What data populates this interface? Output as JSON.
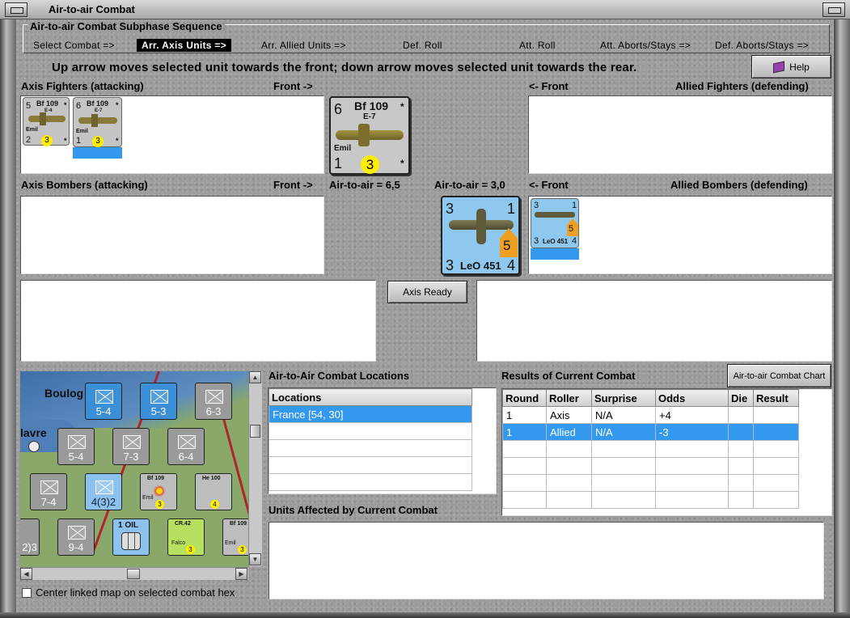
{
  "window": {
    "title": "Air-to-air Combat"
  },
  "sequence": {
    "title": "Air-to-air Combat Subphase Sequence",
    "steps": [
      {
        "label": "Select Combat =>"
      },
      {
        "label": "Arr. Axis Units =>"
      },
      {
        "label": "Arr. Allied Units =>"
      },
      {
        "label": "Def. Roll"
      },
      {
        "label": "Att. Roll"
      },
      {
        "label": "Att. Aborts/Stays =>"
      },
      {
        "label": "Def. Aborts/Stays =>"
      }
    ]
  },
  "instruction": "Up arrow moves selected unit towards the front; down arrow moves selected unit towards the rear.",
  "help_label": "Help",
  "axis_fighters": {
    "label": "Axis Fighters (attacking)",
    "front": "Front ->",
    "counters": [
      {
        "air": "5",
        "name": "Bf 109",
        "variant": "E-4",
        "pilot": "Emil",
        "range": "2",
        "defense": "3",
        "star": "*"
      },
      {
        "air": "6",
        "name": "Bf 109",
        "variant": "E-7",
        "pilot": "Emil",
        "range": "1",
        "defense": "3",
        "star": "*"
      }
    ]
  },
  "selected_axis": {
    "air": "6",
    "name": "Bf 109",
    "variant": "E-7",
    "pilot": "Emil",
    "range": "1",
    "defense": "3",
    "star": "*"
  },
  "allied_fighters": {
    "label": "Allied Fighters (defending)",
    "front": "<- Front"
  },
  "axis_bombers": {
    "label": "Axis Bombers (attacking)",
    "front": "Front ->",
    "air_to_air": "Air-to-air = 6,5"
  },
  "allied_bombers": {
    "label": "Allied Bombers (defending)",
    "front": "<- Front",
    "air_to_air": "Air-to-air = 3,0",
    "counters": [
      {
        "air": "3",
        "air2": "1",
        "name": "LeO 451",
        "bomb": "5",
        "range": "3",
        "move": "4"
      }
    ]
  },
  "selected_allied": {
    "air": "3",
    "air2": "1",
    "name": "LeO 451",
    "bomb": "5",
    "range": "3",
    "move": "4"
  },
  "axis_ready_label": "Axis Ready",
  "locations": {
    "title": "Air-to-Air Combat Locations",
    "header": "Locations",
    "rows": [
      "France [54, 30]"
    ]
  },
  "results": {
    "title": "Results of Current Combat",
    "chart_button": "Air-to-air Combat Chart",
    "columns": [
      "Round",
      "Roller",
      "Surprise",
      "Odds",
      "Die",
      "Result"
    ],
    "rows": [
      [
        "1",
        "Axis",
        "N/A",
        "+4",
        "",
        ""
      ],
      [
        "1",
        "Allied",
        "N/A",
        "-3",
        "",
        ""
      ]
    ]
  },
  "units_affected": {
    "title": "Units Affected by Current Combat"
  },
  "center_map_label": "Center linked map on selected combat hex",
  "map": {
    "labels": [
      "Boulog",
      "lavre"
    ],
    "units": [
      {
        "str": "5-4",
        "type": "xxx",
        "color": "#3a8fd6"
      },
      {
        "str": "5-3",
        "type": "xxx",
        "color": "#3a8fd6"
      },
      {
        "str": "6-3",
        "type": "xxxx",
        "color": "#9a9a9a"
      },
      {
        "str": "5-4",
        "type": "xxx",
        "color": "#9a9a9a"
      },
      {
        "str": "7-3",
        "type": "xxx",
        "color": "#9a9a9a"
      },
      {
        "str": "6-4",
        "type": "xxx",
        "color": "#9a9a9a"
      },
      {
        "str": "7-4",
        "type": "xxx",
        "color": "#9a9a9a"
      },
      {
        "str": "4(3)2",
        "type": "xxxxx",
        "color": "#8ec2ee"
      },
      {
        "str": "9-4",
        "type": "xx",
        "color": "#9a9a9a"
      },
      {
        "str": "2)3",
        "type": "xxx",
        "color": "#9a9a9a"
      }
    ],
    "air": [
      {
        "name": "Bf 109",
        "pilot": "Emil",
        "val": "3"
      },
      {
        "name": "He 100",
        "pilot": "",
        "val": "4"
      },
      {
        "name": "CR.42",
        "pilot": "Falco",
        "val": "3"
      },
      {
        "name": "Bf 109",
        "pilot": "Emil",
        "val": "3"
      }
    ],
    "oil": "1 OIL"
  }
}
